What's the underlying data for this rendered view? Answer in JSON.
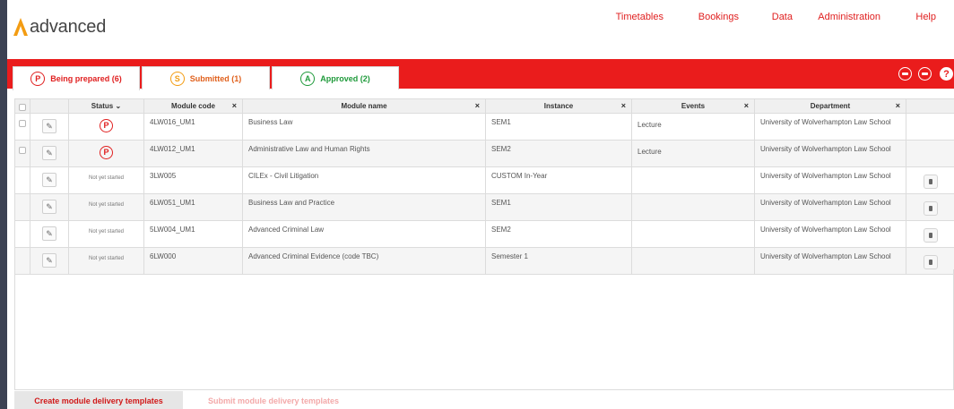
{
  "brand": {
    "name": "advanced",
    "mark_color": "#f39c12"
  },
  "nav": {
    "items": [
      "Timetables",
      "Bookings",
      "Data",
      "Administration",
      "Help"
    ]
  },
  "colors": {
    "accent": "#ea1c1c",
    "approved": "#2e9e3e",
    "submitted": "#f39c12"
  },
  "tabs": [
    {
      "badge": "P",
      "label": "Being prepared (6)",
      "color": "#e02020"
    },
    {
      "badge": "S",
      "label": "Submitted (1)",
      "color": "#e0601c"
    },
    {
      "badge": "A",
      "label": "Approved (2)",
      "color": "#1f9a3b"
    }
  ],
  "tab_actions": {
    "help_glyph": "?"
  },
  "table": {
    "headers": [
      "Status",
      "Module code",
      "Module name",
      "Instance",
      "Events",
      "Department"
    ],
    "sort_indicator": "⌄",
    "clear_glyph": "×",
    "rows": [
      {
        "status": "P",
        "code": "4LW016_UM1",
        "name": "Business Law",
        "instance": "SEM1",
        "events": "Lecture",
        "department": "University of Wolverhampton Law School"
      },
      {
        "status": "P",
        "code": "4LW012_UM1",
        "name": "Administrative Law and Human Rights",
        "instance": "SEM2",
        "events": "Lecture",
        "department": "University of Wolverhampton Law School"
      },
      {
        "status": "Not yet started",
        "code": "3LW005",
        "name": "CILEx - Civil Litigation",
        "instance": "CUSTOM In-Year",
        "events": "",
        "department": "University of Wolverhampton Law School"
      },
      {
        "status": "Not yet started",
        "code": "6LW051_UM1",
        "name": "Business Law and Practice",
        "instance": "SEM1",
        "events": "",
        "department": "University of Wolverhampton Law School"
      },
      {
        "status": "Not yet started",
        "code": "5LW004_UM1",
        "name": "Advanced Criminal Law",
        "instance": "SEM2",
        "events": "",
        "department": "University of Wolverhampton Law School"
      },
      {
        "status": "Not yet started",
        "code": "6LW000",
        "name": "Advanced Criminal Evidence (code TBC)",
        "instance": "Semester 1",
        "events": "",
        "department": "University of Wolverhampton Law School"
      }
    ]
  },
  "footer": {
    "create_label": "Create module delivery templates",
    "submit_label": "Submit module delivery templates"
  }
}
